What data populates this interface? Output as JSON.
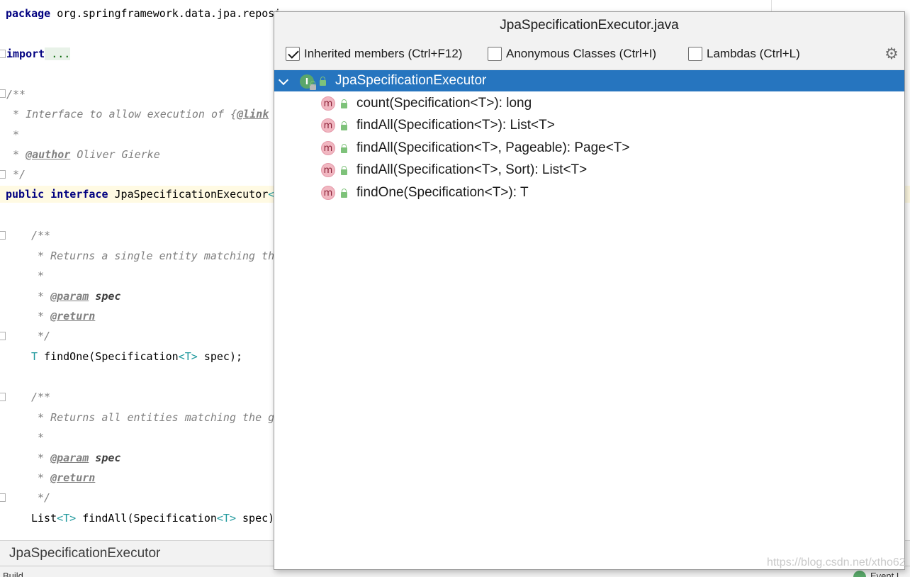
{
  "editor": {
    "lines": {
      "package_kw": "package",
      "package_name": " org.springframework.data.jpa.reposi",
      "import_kw": "import",
      "import_fold": " ...",
      "doc1_open": "/**",
      "doc1_line1_pre": " * Interface to allow execution of {",
      "doc1_line1_tag": "@link",
      "doc1_star": " *",
      "doc1_author_pre": " * ",
      "doc1_author_tag": "@author",
      "doc1_author_text": " Oliver Gierke",
      "doc1_close": " */",
      "decl_public": "public",
      "decl_interface": " interface",
      "decl_name": " JpaSpecificationExecutor",
      "decl_lt": "<",
      "doc2_open": "/**",
      "doc2_line1": " * Returns a single entity matching th",
      "doc2_star": " *",
      "doc2_param_pre": " * ",
      "doc2_param_tag": "@param",
      "doc2_param_name": " spec",
      "doc2_return_pre": " * ",
      "doc2_return_tag": "@return",
      "doc2_close": " */",
      "m1_type": "T",
      "m1_sig": " findOne(Specification",
      "m1_tp": "<T>",
      "m1_rest": " spec);",
      "doc3_open": "/**",
      "doc3_line1": " * Returns all entities matching the g",
      "doc3_star": " *",
      "doc3_param_pre": " * ",
      "doc3_param_tag": "@param",
      "doc3_param_name": " spec",
      "doc3_return_pre": " * ",
      "doc3_return_tag": "@return",
      "doc3_close": " */",
      "m2_list": "List",
      "m2_tp1": "<T>",
      "m2_sig": " findAll(Specification",
      "m2_tp2": "<T>",
      "m2_rest": " spec)"
    }
  },
  "navbar": {
    "label": "JpaSpecificationExecutor"
  },
  "statusbar": {
    "left_text": "Build",
    "right_text": "Event L"
  },
  "popup": {
    "title": "JpaSpecificationExecutor.java",
    "options": {
      "inherited": {
        "label": "Inherited members (Ctrl+F12)",
        "checked": true
      },
      "anonymous": {
        "label": "Anonymous Classes (Ctrl+I)",
        "checked": false
      },
      "lambdas": {
        "label": "Lambdas (Ctrl+L)",
        "checked": false
      }
    },
    "settings_icon": "gear-icon",
    "tree": {
      "root": {
        "icon_letter": "I",
        "label": "JpaSpecificationExecutor"
      },
      "methods": [
        {
          "icon_letter": "m",
          "label": "count(Specification<T>): long"
        },
        {
          "icon_letter": "m",
          "label": "findAll(Specification<T>): List<T>"
        },
        {
          "icon_letter": "m",
          "label": "findAll(Specification<T>, Pageable): Page<T>"
        },
        {
          "icon_letter": "m",
          "label": "findAll(Specification<T>, Sort): List<T>"
        },
        {
          "icon_letter": "m",
          "label": "findOne(Specification<T>): T"
        }
      ]
    }
  },
  "watermark": "https://blog.csdn.net/xtho62",
  "colors": {
    "selection": "#2675bf",
    "interface_icon": "#5aa66b",
    "method_icon": "#f1b7c1",
    "lock_badge": "#7ec27a",
    "keyword": "#000080",
    "comment": "#808080",
    "type_param": "#20999d"
  }
}
